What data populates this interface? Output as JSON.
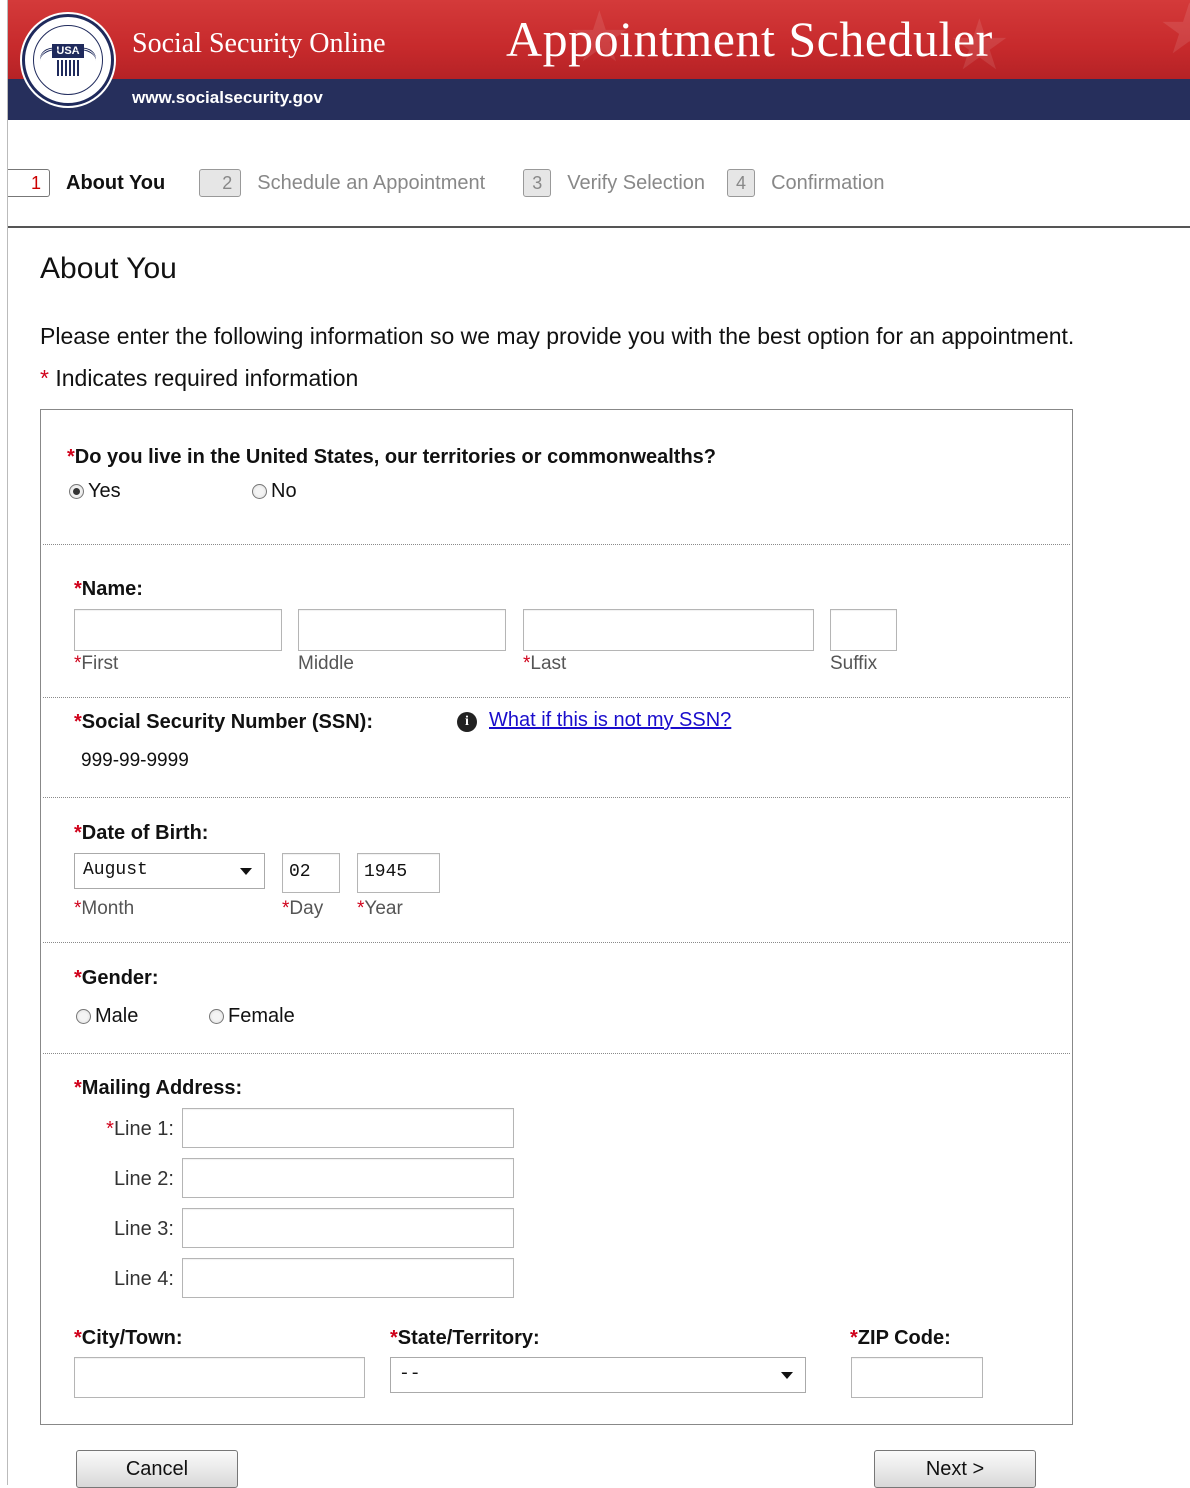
{
  "header": {
    "brand": "Social Security Online",
    "app_title": "Appointment Scheduler",
    "url": "www.socialsecurity.gov",
    "seal_text": "SOCIAL SECURITY ADMINISTRATION USA",
    "colors": {
      "red": "#c72a2c",
      "navy": "#262f5c"
    }
  },
  "steps": [
    {
      "num": "1",
      "label": "About You",
      "active": true
    },
    {
      "num": "2",
      "label": "Schedule an Appointment",
      "active": false
    },
    {
      "num": "3",
      "label": "Verify Selection",
      "active": false
    },
    {
      "num": "4",
      "label": "Confirmation",
      "active": false
    }
  ],
  "page": {
    "title": "About You",
    "intro": "Please enter the following information so we may provide you with the best option for an appointment.",
    "required_mark": "*",
    "required_note": " Indicates required information"
  },
  "form": {
    "residence": {
      "question": "Do you live in the United States, our territories or commonwealths?",
      "options": [
        "Yes",
        "No"
      ],
      "selected": "Yes"
    },
    "name": {
      "label": "Name:",
      "first": "First",
      "middle": "Middle",
      "last": "Last",
      "suffix": "Suffix"
    },
    "ssn": {
      "label": "Social Security Number (SSN):",
      "help_link": "What if this is not my SSN?",
      "value": "999-99-9999"
    },
    "dob": {
      "label": "Date of Birth:",
      "month_value": "August",
      "day_value": "02",
      "year_value": "1945",
      "month_label": "Month",
      "day_label": "Day",
      "year_label": "Year"
    },
    "gender": {
      "label": "Gender:",
      "options": [
        "Male",
        "Female"
      ]
    },
    "address": {
      "label": "Mailing Address:",
      "line1": "Line 1:",
      "line2": "Line 2:",
      "line3": "Line 3:",
      "line4": "Line 4:",
      "city": "City/Town:",
      "state": "State/Territory:",
      "state_value": "--",
      "zip": "ZIP Code:"
    }
  },
  "buttons": {
    "cancel": "Cancel",
    "next": "Next >"
  }
}
